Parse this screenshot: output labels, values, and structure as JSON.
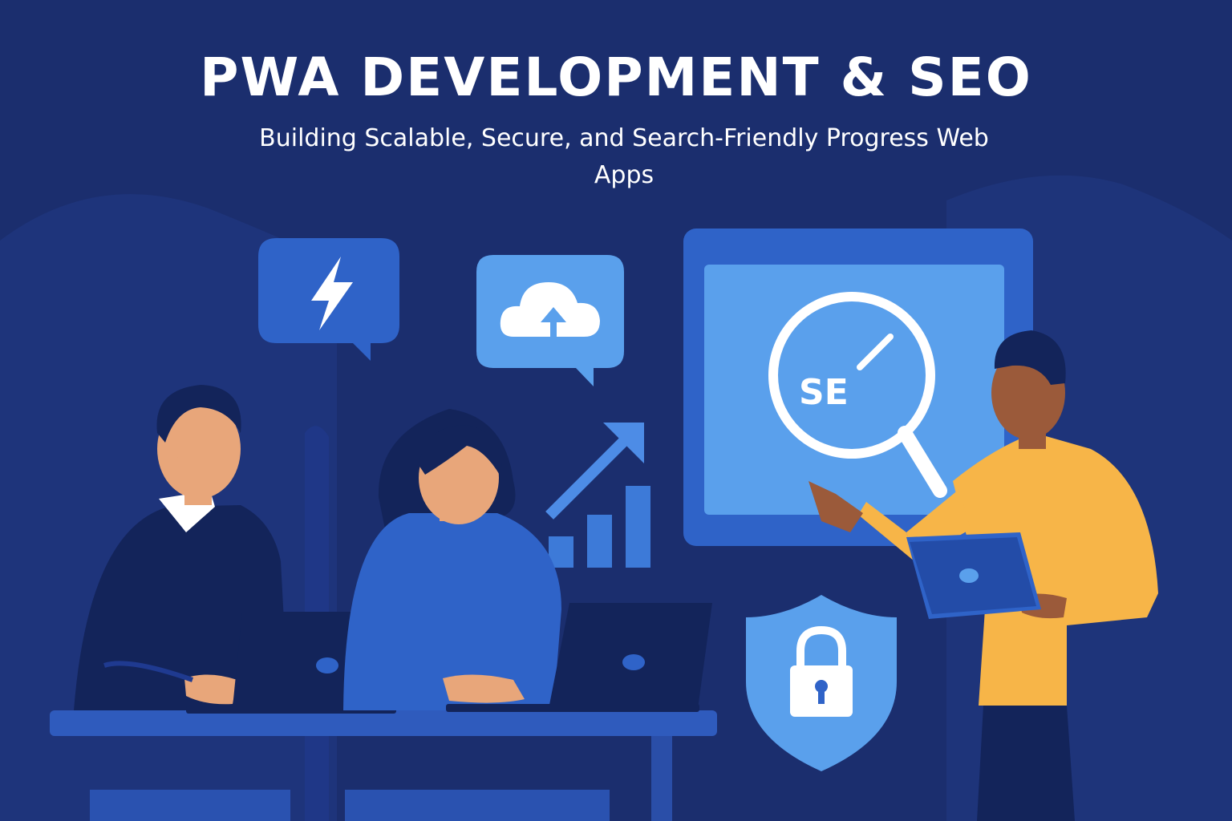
{
  "header": {
    "title": "PWA DEVELOPMENT & SEO",
    "subtitle": "Building Scalable, Secure, and Search-Friendly Progress Web Apps"
  },
  "illustration": {
    "screen_text": "SE",
    "icons": [
      "lightning-icon",
      "cloud-upload-icon",
      "growth-chart-icon",
      "search-check-icon",
      "shield-lock-icon"
    ]
  },
  "colors": {
    "background": "#1b2e6e",
    "panel_blue": "#2f63c8",
    "light_blue": "#5aa0ec",
    "navy": "#13245a",
    "accent_yellow": "#f7b548"
  }
}
